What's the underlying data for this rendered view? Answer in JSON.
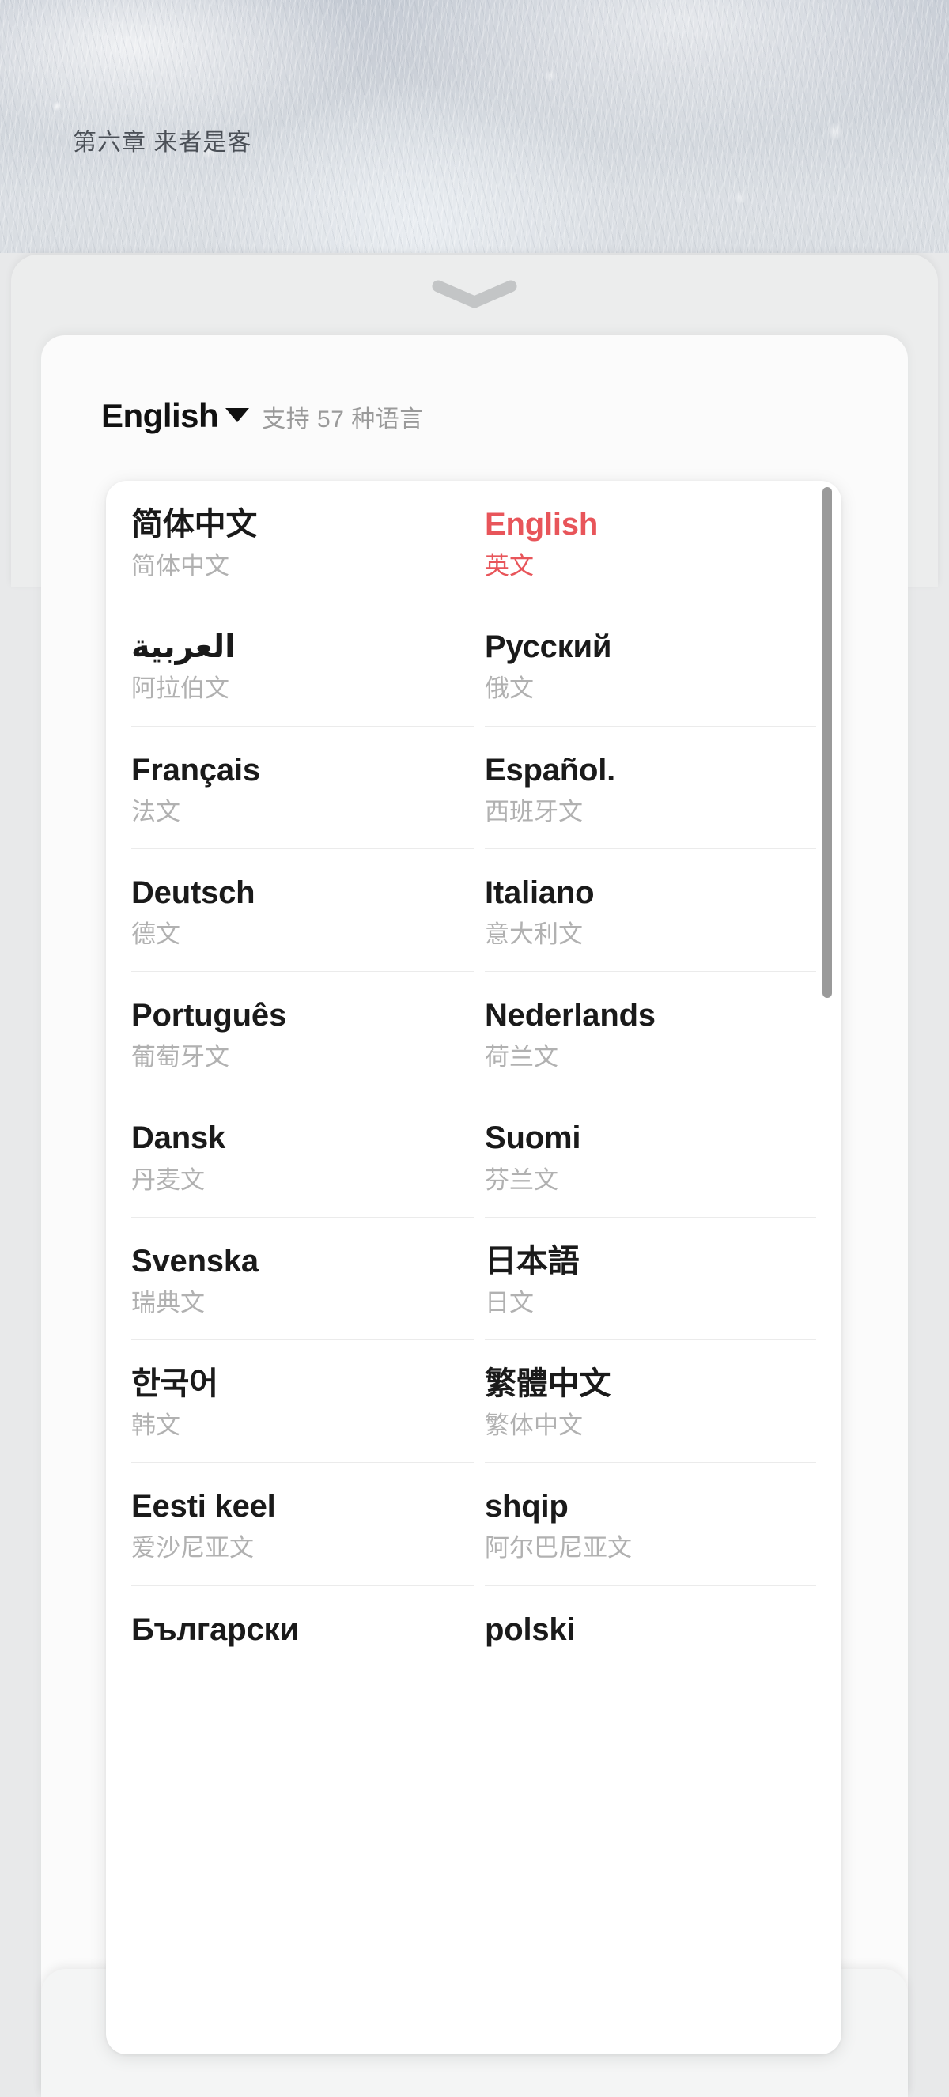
{
  "background": {
    "chapter_title": "第六章 来者是客"
  },
  "sheet": {
    "grabber_icon": "chevron-down-icon"
  },
  "header": {
    "current_language": "English",
    "dropdown_icon": "caret-down-icon",
    "supported_count_text": "支持 57 种语言"
  },
  "colors": {
    "selected": "#e8555a",
    "primary_text": "#1a1a1a",
    "secondary_text": "#b1b1b1",
    "card_background": "#ffffff",
    "sheet_background": "#fbfbfb",
    "scrollbar": "#9a9a9a"
  },
  "scrollbar": {
    "orientation": "vertical",
    "thumb_position": "top"
  },
  "language_list": {
    "rows": [
      [
        {
          "native": "简体中文",
          "chinese": "简体中文",
          "selected": false,
          "rtl": false
        },
        {
          "native": "English",
          "chinese": "英文",
          "selected": true,
          "rtl": false
        }
      ],
      [
        {
          "native": "العربية",
          "chinese": "阿拉伯文",
          "selected": false,
          "rtl": true
        },
        {
          "native": "Русский",
          "chinese": "俄文",
          "selected": false,
          "rtl": false
        }
      ],
      [
        {
          "native": "Français",
          "chinese": "法文",
          "selected": false,
          "rtl": false
        },
        {
          "native": "Español.",
          "chinese": "西班牙文",
          "selected": false,
          "rtl": false
        }
      ],
      [
        {
          "native": "Deutsch",
          "chinese": "德文",
          "selected": false,
          "rtl": false
        },
        {
          "native": "Italiano",
          "chinese": "意大利文",
          "selected": false,
          "rtl": false
        }
      ],
      [
        {
          "native": "Português",
          "chinese": "葡萄牙文",
          "selected": false,
          "rtl": false
        },
        {
          "native": "Nederlands",
          "chinese": "荷兰文",
          "selected": false,
          "rtl": false
        }
      ],
      [
        {
          "native": "Dansk",
          "chinese": "丹麦文",
          "selected": false,
          "rtl": false
        },
        {
          "native": "Suomi",
          "chinese": "芬兰文",
          "selected": false,
          "rtl": false
        }
      ],
      [
        {
          "native": "Svenska",
          "chinese": "瑞典文",
          "selected": false,
          "rtl": false
        },
        {
          "native": "日本語",
          "chinese": "日文",
          "selected": false,
          "rtl": false
        }
      ],
      [
        {
          "native": "한국어",
          "chinese": "韩文",
          "selected": false,
          "rtl": false
        },
        {
          "native": "繁體中文",
          "chinese": "繁体中文",
          "selected": false,
          "rtl": false
        }
      ],
      [
        {
          "native": "Eesti keel",
          "chinese": "爱沙尼亚文",
          "selected": false,
          "rtl": false
        },
        {
          "native": "shqip",
          "chinese": "阿尔巴尼亚文",
          "selected": false,
          "rtl": false
        }
      ],
      [
        {
          "native": "Български",
          "chinese": "",
          "selected": false,
          "rtl": false
        },
        {
          "native": "polski",
          "chinese": "",
          "selected": false,
          "rtl": false
        }
      ]
    ]
  }
}
